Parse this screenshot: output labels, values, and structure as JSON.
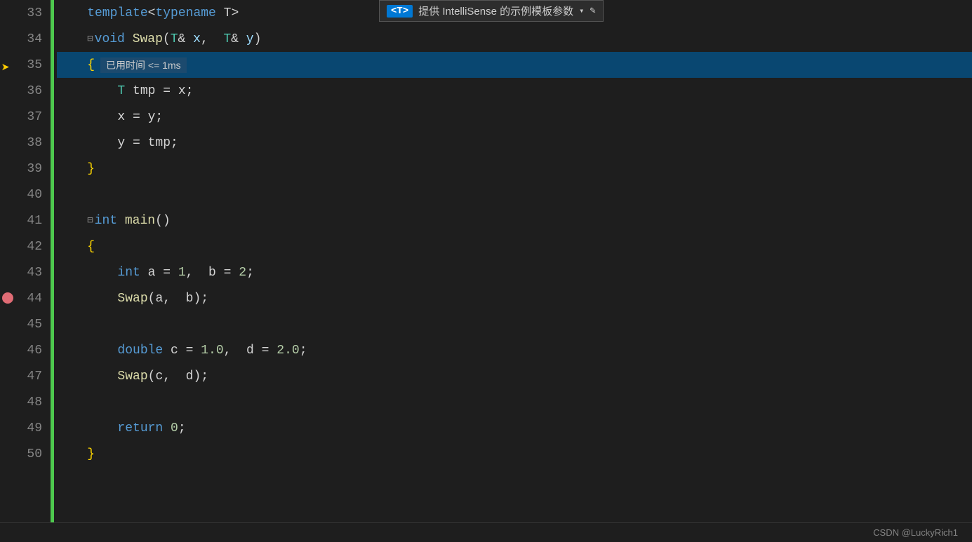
{
  "intellisense": {
    "badge": "<T>",
    "text": "提供 IntelliSense 的示例模板参数",
    "arrow": "▾",
    "edit_icon": "✎"
  },
  "bottom_bar": {
    "credit": "CSDN @LuckyRich1"
  },
  "lines": [
    {
      "number": "33",
      "tokens": [
        {
          "text": "    template",
          "class": "blue"
        },
        {
          "text": "<",
          "class": "plain"
        },
        {
          "text": "typename",
          "class": "blue"
        },
        {
          "text": " T",
          "class": "plain"
        },
        {
          "text": ">",
          "class": "plain"
        }
      ],
      "indent_level": 1,
      "has_fold": false,
      "fold_type": ""
    },
    {
      "number": "34",
      "tokens": [
        {
          "text": "    ",
          "class": "plain"
        },
        {
          "text": "□",
          "class": "folded"
        },
        {
          "text": "void",
          "class": "blue"
        },
        {
          "text": " Swap",
          "class": "yellow"
        },
        {
          "text": "(",
          "class": "plain"
        },
        {
          "text": "T",
          "class": "cyan"
        },
        {
          "text": "& ",
          "class": "plain"
        },
        {
          "text": "x",
          "class": "light-blue"
        },
        {
          "text": ",  ",
          "class": "plain"
        },
        {
          "text": "T",
          "class": "cyan"
        },
        {
          "text": "& ",
          "class": "plain"
        },
        {
          "text": "y",
          "class": "light-blue"
        },
        {
          "text": ")",
          "class": "plain"
        }
      ],
      "indent_level": 1,
      "has_fold": true,
      "fold_type": "minus"
    },
    {
      "number": "35",
      "highlighted": true,
      "tokens": [
        {
          "text": "    {",
          "class": "punc"
        },
        {
          "text": "  已用时间 <= 1ms",
          "class": "time-badge-inline"
        }
      ],
      "indent_level": 2,
      "has_fold": false,
      "fold_type": ""
    },
    {
      "number": "36",
      "tokens": [
        {
          "text": "        ",
          "class": "plain"
        },
        {
          "text": "T",
          "class": "cyan"
        },
        {
          "text": " tmp = x;",
          "class": "plain"
        }
      ],
      "indent_level": 3,
      "has_fold": false
    },
    {
      "number": "37",
      "tokens": [
        {
          "text": "        x = y;",
          "class": "plain"
        }
      ],
      "indent_level": 3,
      "has_fold": false
    },
    {
      "number": "38",
      "tokens": [
        {
          "text": "        y = tmp;",
          "class": "plain"
        }
      ],
      "indent_level": 3,
      "has_fold": false
    },
    {
      "number": "39",
      "tokens": [
        {
          "text": "    }",
          "class": "punc"
        }
      ],
      "indent_level": 2,
      "has_fold": false
    },
    {
      "number": "40",
      "tokens": [],
      "indent_level": 0,
      "has_fold": false
    },
    {
      "number": "41",
      "tokens": [
        {
          "text": "    ",
          "class": "plain"
        },
        {
          "text": "□",
          "class": "folded"
        },
        {
          "text": "int",
          "class": "blue"
        },
        {
          "text": " main",
          "class": "yellow"
        },
        {
          "text": "()",
          "class": "plain"
        }
      ],
      "indent_level": 1,
      "has_fold": true,
      "fold_type": "minus"
    },
    {
      "number": "42",
      "tokens": [
        {
          "text": "    {",
          "class": "punc"
        }
      ],
      "indent_level": 2,
      "has_fold": false
    },
    {
      "number": "43",
      "tokens": [
        {
          "text": "        ",
          "class": "plain"
        },
        {
          "text": "int",
          "class": "blue"
        },
        {
          "text": " a = 1,  b = 2;",
          "class": "plain"
        }
      ],
      "indent_level": 3,
      "has_fold": false
    },
    {
      "number": "44",
      "tokens": [
        {
          "text": "        ",
          "class": "plain"
        },
        {
          "text": "Swap",
          "class": "yellow"
        },
        {
          "text": "(a,  b);",
          "class": "plain"
        }
      ],
      "indent_level": 3,
      "has_fold": false,
      "breakpoint": true
    },
    {
      "number": "45",
      "tokens": [],
      "indent_level": 0,
      "has_fold": false
    },
    {
      "number": "46",
      "tokens": [
        {
          "text": "        ",
          "class": "plain"
        },
        {
          "text": "double",
          "class": "blue"
        },
        {
          "text": " c = 1.0,  d = 2.0;",
          "class": "plain"
        }
      ],
      "indent_level": 3,
      "has_fold": false
    },
    {
      "number": "47",
      "tokens": [
        {
          "text": "        ",
          "class": "plain"
        },
        {
          "text": "Swap",
          "class": "yellow"
        },
        {
          "text": "(c,  d);",
          "class": "plain"
        }
      ],
      "indent_level": 3,
      "has_fold": false
    },
    {
      "number": "48",
      "tokens": [],
      "indent_level": 0,
      "has_fold": false
    },
    {
      "number": "49",
      "tokens": [
        {
          "text": "        ",
          "class": "plain"
        },
        {
          "text": "return",
          "class": "blue"
        },
        {
          "text": " 0;",
          "class": "plain"
        }
      ],
      "indent_level": 3,
      "has_fold": false
    },
    {
      "number": "50",
      "tokens": [
        {
          "text": "    }",
          "class": "punc"
        }
      ],
      "indent_level": 2,
      "has_fold": false
    }
  ]
}
